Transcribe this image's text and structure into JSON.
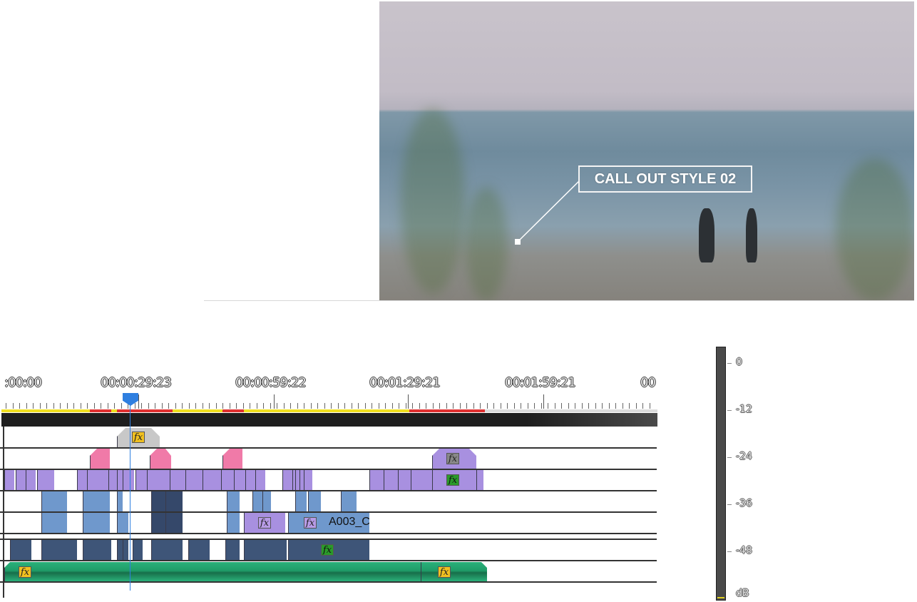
{
  "preview": {
    "callout_text": "CALL OUT STYLE 02"
  },
  "timeline": {
    "timecodes": [
      ":00:00",
      "00:00:29:23",
      "00:00:59:22",
      "00:01:29:21",
      "00:01:59:21",
      "00"
    ],
    "clip_label": "A003_C",
    "fx_label": "fx"
  },
  "meter": {
    "scale": [
      "0",
      "-12",
      "-24",
      "-36",
      "-48",
      "dB"
    ]
  },
  "colors": {
    "video_clip": "#a890e0",
    "adjustment_clip": "#f07aa8",
    "video_clip_blue": "#6f98cc",
    "audio_clip": "#2bb07a",
    "playhead": "#2f7fe0",
    "render_bar_yellow": "#f0e020",
    "render_bar_red": "#e03030"
  }
}
